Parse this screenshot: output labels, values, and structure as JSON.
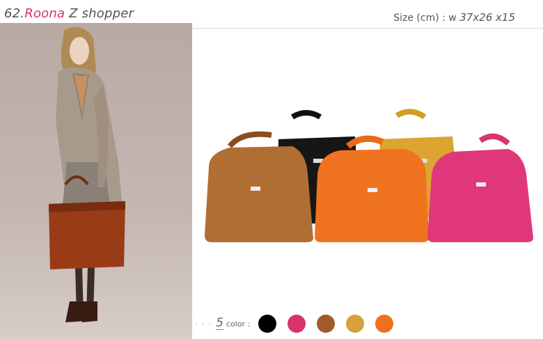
{
  "header": {
    "number": "62.",
    "brand": "Roona",
    "product": " Z shopper",
    "size_label": "Size (cm) : w ",
    "size_dims": "37x26 x15"
  },
  "colors": {
    "count": "5",
    "label": "color :",
    "swatches": [
      "#000000",
      "#d8336a",
      "#a35a2a",
      "#d6a03b",
      "#f07020"
    ]
  },
  "accent": "#d8335f"
}
